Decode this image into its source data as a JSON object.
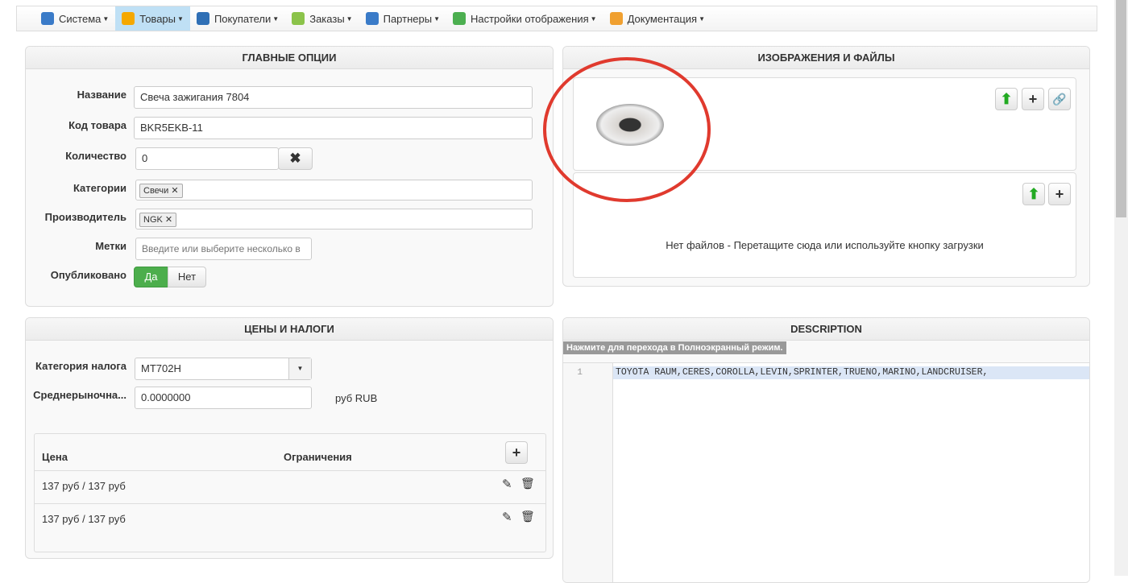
{
  "nav": [
    {
      "label": "Система",
      "icon": "tools-icon",
      "color": "#3a7bc8"
    },
    {
      "label": "Товары",
      "icon": "box-icon",
      "color": "#f5a800",
      "active": true
    },
    {
      "label": "Покупатели",
      "icon": "users-icon",
      "color": "#2f6fb5"
    },
    {
      "label": "Заказы",
      "icon": "orders-icon",
      "color": "#8bc34a"
    },
    {
      "label": "Партнеры",
      "icon": "partners-icon",
      "color": "#3a7bc8"
    },
    {
      "label": "Настройки отображения",
      "icon": "display-settings-icon",
      "color": "#4caf50"
    },
    {
      "label": "Документация",
      "icon": "docs-icon",
      "color": "#f0a030"
    }
  ],
  "main": {
    "title": "ГЛАВНЫЕ ОПЦИИ",
    "name_label": "Название",
    "name": "Свеча зажигания 7804",
    "sku_label": "Код товара",
    "sku": "BKR5EKB-11",
    "qty_label": "Количество",
    "qty": "0",
    "cat_label": "Категории",
    "cat_tag": "Свечи",
    "man_label": "Производитель",
    "man_tag": "NGK",
    "tags_label": "Метки",
    "tags_placeholder": "Введите или выберите несколько в",
    "pub_label": "Опубликовано",
    "yes": "Да",
    "no": "Нет"
  },
  "images": {
    "title": "ИЗОБРАЖЕНИЯ И ФАЙЛЫ",
    "no_files": "Нет файлов - Перетащите сюда или используйте кнопку загрузки"
  },
  "prices": {
    "title": "ЦЕНЫ И НАЛОГИ",
    "tax_label": "Категория налога",
    "tax": "MT702H",
    "avg_label": "Среднерыночна...",
    "avg": "0.0000000",
    "currency": "руб RUB",
    "col_price": "Цена",
    "col_limits": "Ограничения",
    "rows": [
      "137 руб / 137 руб",
      "137 руб / 137 руб"
    ]
  },
  "desc": {
    "title": "DESCRIPTION",
    "fullscreen": "Нажмите для перехода в Полноэкранный режим.",
    "line_no": "1",
    "text": "TOYOTA RAUM,CERES,COROLLA,LEVIN,SPRINTER,TRUENO,MARINO,LANDCRUISER,"
  }
}
